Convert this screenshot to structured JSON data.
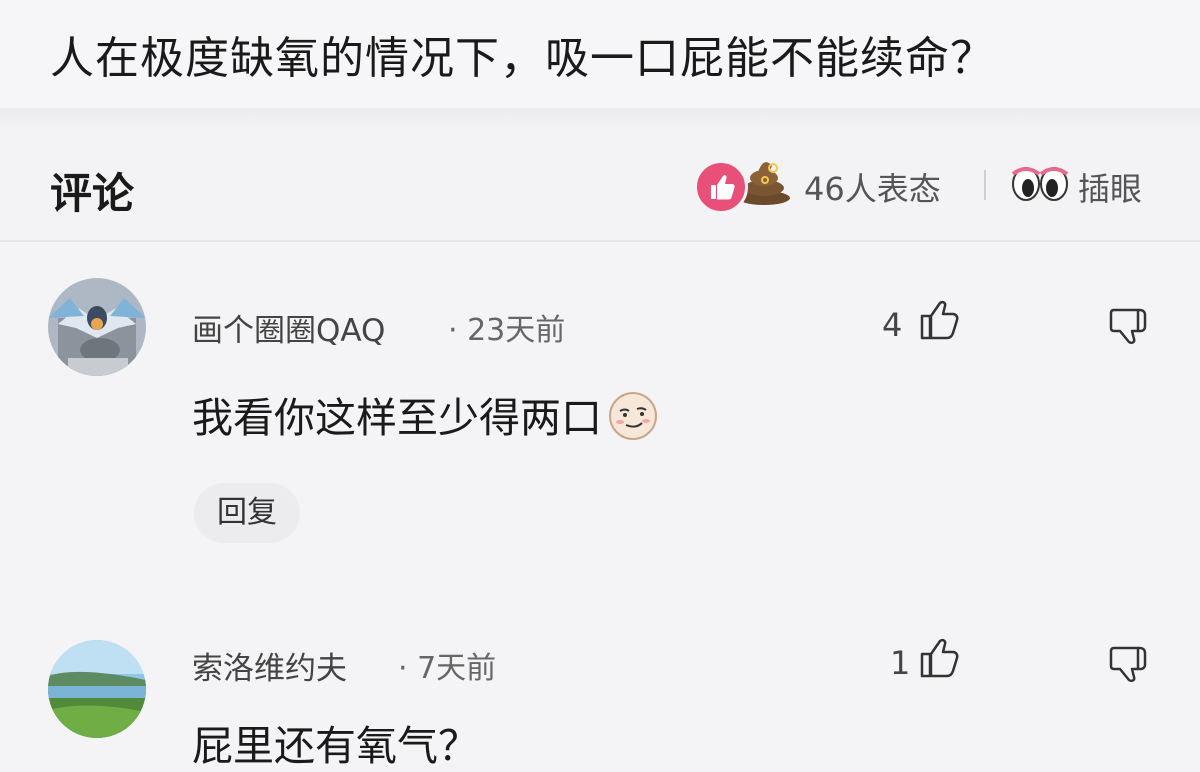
{
  "question": {
    "title": "人在极度缺氧的情况下，吸一口屁能不能续命？"
  },
  "comments_header": {
    "title": "评论",
    "reaction_count": "46人表态",
    "eyes_label": "插眼"
  },
  "colors": {
    "like_badge": "#e8507a",
    "background": "#f4f4f6"
  },
  "comments": [
    {
      "username": "画个圈圈QAQ",
      "time": "· 23天前",
      "likes": "4",
      "text": "我看你这样至少得两口",
      "reply_label": "回复",
      "emoji": "smirk-face-icon"
    },
    {
      "username": "索洛维约夫",
      "time": "· 7天前",
      "likes": "1",
      "text": "屁里还有氧气？"
    }
  ]
}
